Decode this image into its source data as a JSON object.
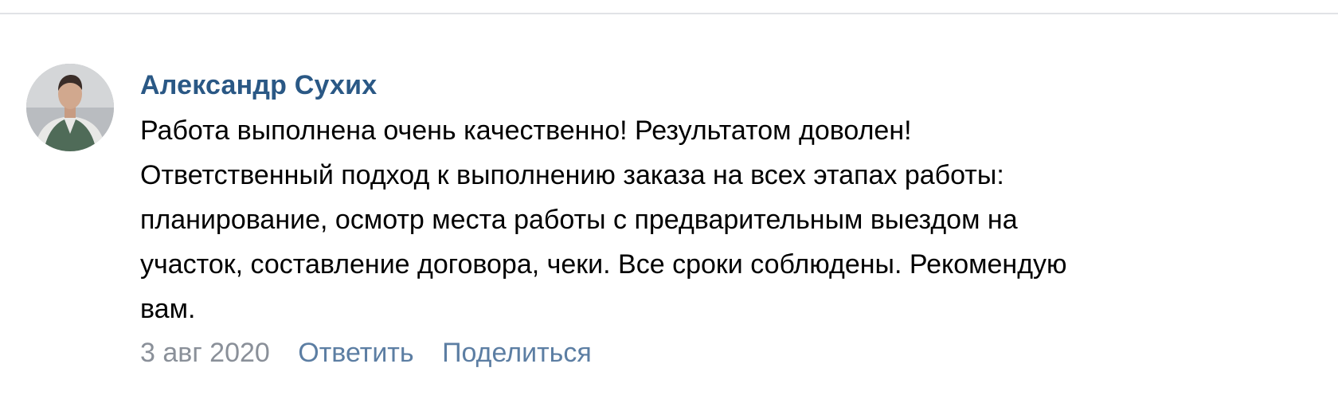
{
  "comment": {
    "author": "Александр Сухих",
    "lines": [
      "Работа выполнена очень качественно! Результатом доволен!",
      "Ответственный подход к выполнению заказа на всех этапах работы:",
      "планирование, осмотр места работы с предварительным выездом на",
      "участок, составление договора, чеки. Все сроки соблюдены. Рекомендую",
      "вам."
    ],
    "date": "3 авг 2020",
    "reply_label": "Ответить",
    "share_label": "Поделиться"
  },
  "colors": {
    "author": "#2a5885",
    "action": "#5c7ea3",
    "date": "#8a9099",
    "divider": "#e1e3e6"
  },
  "icons": {
    "avatar": "user-photo"
  }
}
